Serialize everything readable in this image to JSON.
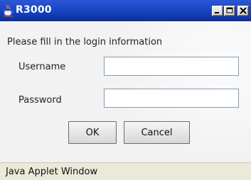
{
  "window": {
    "title": "R3000",
    "icon": "java-cup-icon"
  },
  "titlebar_buttons": [
    "minimize-icon",
    "maximize-icon",
    "close-icon"
  ],
  "form": {
    "prompt": "Please fill in the login information",
    "username_label": "Username",
    "password_label": "Password",
    "username_value": "",
    "password_value": ""
  },
  "buttons": {
    "ok_label": "OK",
    "cancel_label": "Cancel"
  },
  "status": {
    "text": "Java Applet Window"
  },
  "colors": {
    "titlebar": "#1c48c8",
    "content_bg": "#f2f2f2",
    "status_bg": "#ece9d8"
  }
}
